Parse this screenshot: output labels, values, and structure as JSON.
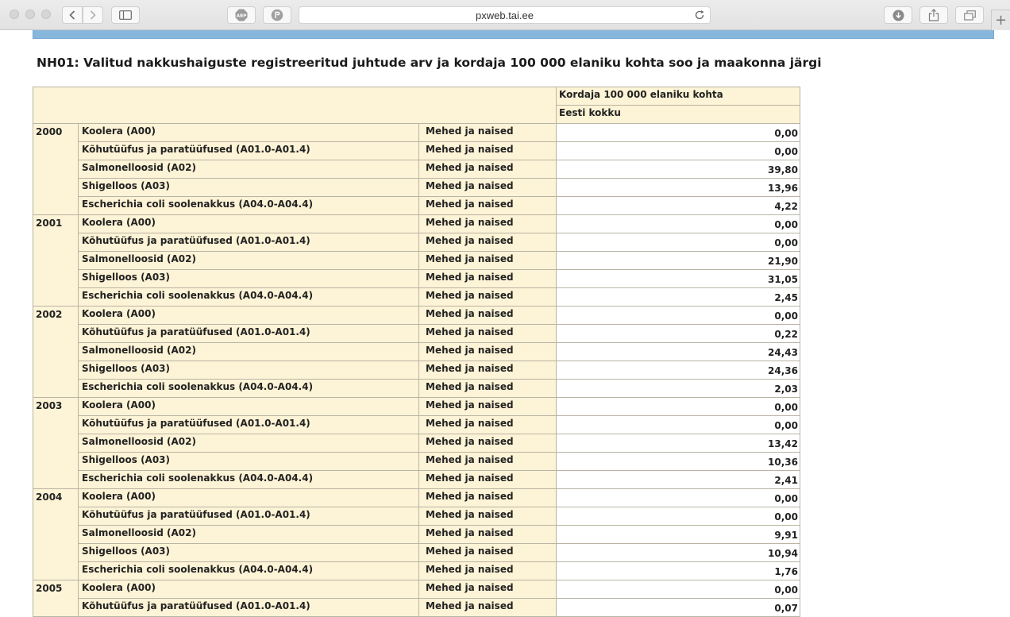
{
  "browser": {
    "url": "pxweb.tai.ee",
    "new_tab_label": "+"
  },
  "page": {
    "title": "NH01: Valitud nakkushaiguste registreeritud juhtude arv ja kordaja 100 000 elaniku kohta soo ja maakonna järgi"
  },
  "table": {
    "header_measure": "Kordaja 100 000 elaniku kohta",
    "header_region": "Eesti kokku",
    "years": [
      {
        "year": "2000",
        "rows": [
          {
            "disease": "Koolera (A00)",
            "sex": "Mehed ja naised",
            "value": "0,00"
          },
          {
            "disease": "Kõhutüüfus ja paratüüfused (A01.0-A01.4)",
            "sex": "Mehed ja naised",
            "value": "0,00"
          },
          {
            "disease": "Salmonelloosid (A02)",
            "sex": "Mehed ja naised",
            "value": "39,80"
          },
          {
            "disease": "Shigelloos (A03)",
            "sex": "Mehed ja naised",
            "value": "13,96"
          },
          {
            "disease": "Escherichia coli soolenakkus (A04.0-A04.4)",
            "sex": "Mehed ja naised",
            "value": "4,22"
          }
        ]
      },
      {
        "year": "2001",
        "rows": [
          {
            "disease": "Koolera (A00)",
            "sex": "Mehed ja naised",
            "value": "0,00"
          },
          {
            "disease": "Kõhutüüfus ja paratüüfused (A01.0-A01.4)",
            "sex": "Mehed ja naised",
            "value": "0,00"
          },
          {
            "disease": "Salmonelloosid (A02)",
            "sex": "Mehed ja naised",
            "value": "21,90"
          },
          {
            "disease": "Shigelloos (A03)",
            "sex": "Mehed ja naised",
            "value": "31,05"
          },
          {
            "disease": "Escherichia coli soolenakkus (A04.0-A04.4)",
            "sex": "Mehed ja naised",
            "value": "2,45"
          }
        ]
      },
      {
        "year": "2002",
        "rows": [
          {
            "disease": "Koolera (A00)",
            "sex": "Mehed ja naised",
            "value": "0,00"
          },
          {
            "disease": "Kõhutüüfus ja paratüüfused (A01.0-A01.4)",
            "sex": "Mehed ja naised",
            "value": "0,22"
          },
          {
            "disease": "Salmonelloosid (A02)",
            "sex": "Mehed ja naised",
            "value": "24,43"
          },
          {
            "disease": "Shigelloos (A03)",
            "sex": "Mehed ja naised",
            "value": "24,36"
          },
          {
            "disease": "Escherichia coli soolenakkus (A04.0-A04.4)",
            "sex": "Mehed ja naised",
            "value": "2,03"
          }
        ]
      },
      {
        "year": "2003",
        "rows": [
          {
            "disease": "Koolera (A00)",
            "sex": "Mehed ja naised",
            "value": "0,00"
          },
          {
            "disease": "Kõhutüüfus ja paratüüfused (A01.0-A01.4)",
            "sex": "Mehed ja naised",
            "value": "0,00"
          },
          {
            "disease": "Salmonelloosid (A02)",
            "sex": "Mehed ja naised",
            "value": "13,42"
          },
          {
            "disease": "Shigelloos (A03)",
            "sex": "Mehed ja naised",
            "value": "10,36"
          },
          {
            "disease": "Escherichia coli soolenakkus (A04.0-A04.4)",
            "sex": "Mehed ja naised",
            "value": "2,41"
          }
        ]
      },
      {
        "year": "2004",
        "rows": [
          {
            "disease": "Koolera (A00)",
            "sex": "Mehed ja naised",
            "value": "0,00"
          },
          {
            "disease": "Kõhutüüfus ja paratüüfused (A01.0-A01.4)",
            "sex": "Mehed ja naised",
            "value": "0,00"
          },
          {
            "disease": "Salmonelloosid (A02)",
            "sex": "Mehed ja naised",
            "value": "9,91"
          },
          {
            "disease": "Shigelloos (A03)",
            "sex": "Mehed ja naised",
            "value": "10,94"
          },
          {
            "disease": "Escherichia coli soolenakkus (A04.0-A04.4)",
            "sex": "Mehed ja naised",
            "value": "1,76"
          }
        ]
      },
      {
        "year": "2005",
        "rows": [
          {
            "disease": "Koolera (A00)",
            "sex": "Mehed ja naised",
            "value": "0,00"
          },
          {
            "disease": "Kõhutüüfus ja paratüüfused (A01.0-A01.4)",
            "sex": "Mehed ja naised",
            "value": "0,07"
          }
        ]
      }
    ]
  }
}
